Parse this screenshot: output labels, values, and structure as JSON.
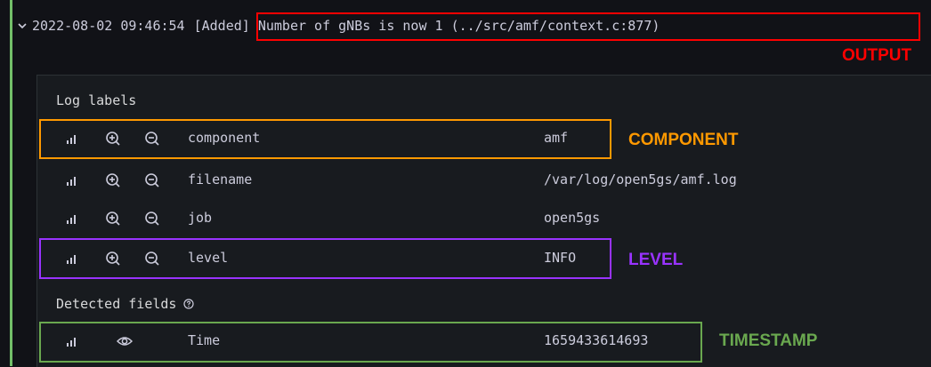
{
  "log_line": {
    "timestamp": "2022-08-02 09:46:54",
    "message": "[Added] Number of gNBs is now 1 (../src/amf/context.c:877)"
  },
  "log_labels": {
    "title": "Log labels",
    "items": [
      {
        "key": "component",
        "value": "amf"
      },
      {
        "key": "filename",
        "value": "/var/log/open5gs/amf.log"
      },
      {
        "key": "job",
        "value": "open5gs"
      },
      {
        "key": "level",
        "value": "INFO"
      }
    ]
  },
  "detected_fields": {
    "title": "Detected fields",
    "items": [
      {
        "key": "Time",
        "value": "1659433614693"
      }
    ]
  },
  "annotations": {
    "output": {
      "label": "OUTPUT",
      "color": "#ff0000"
    },
    "component": {
      "label": "COMPONENT",
      "color": "#ff9900"
    },
    "level": {
      "label": "LEVEL",
      "color": "#9933ff"
    },
    "timestamp": {
      "label": "TIMESTAMP",
      "color": "#6aa84f"
    }
  },
  "colors": {
    "background": "#111217",
    "panel": "#181b1f",
    "log_level_bar": "#73bf69",
    "text": "#ccccdc"
  }
}
